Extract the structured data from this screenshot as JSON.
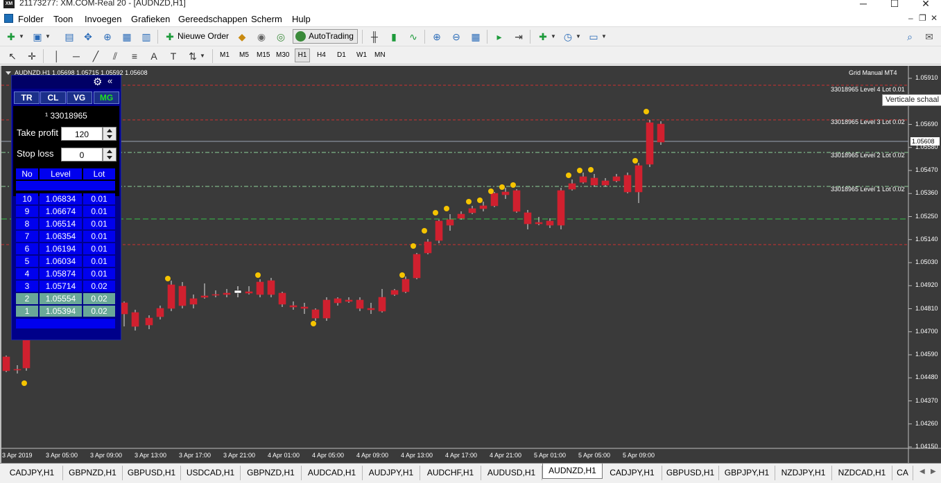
{
  "window": {
    "title": "21173277: XM.COM-Real 20 - [AUDNZD,H1]",
    "app_icon_text": "XM"
  },
  "menu": [
    "Folder",
    "Toon",
    "Invoegen",
    "Grafieken",
    "Gereedschappen",
    "Scherm",
    "Hulp"
  ],
  "toolbar": {
    "new_order_label": "Nieuwe Order",
    "autotrading_label": "AutoTrading",
    "timeframes": [
      "M1",
      "M5",
      "M15",
      "M30",
      "H1",
      "H4",
      "D1",
      "W1",
      "MN"
    ],
    "active_timeframe": "H1"
  },
  "chart": {
    "header": "AUDNZD,H1  1.05698 1.05715 1.05592 1.05608",
    "ea_label": "Grid Manual MT4",
    "tooltip": "Verticale schaal",
    "current_price": "1.05608",
    "price_ticks": [
      "1.05910",
      "1.05690",
      "1.05580",
      "1.05470",
      "1.05360",
      "1.05250",
      "1.05140",
      "1.05030",
      "1.04920",
      "1.04810",
      "1.04700",
      "1.04590",
      "1.04480",
      "1.04370",
      "1.04260",
      "1.04150"
    ],
    "time_ticks": [
      "3 Apr 2019",
      "3 Apr 05:00",
      "3 Apr 09:00",
      "3 Apr 13:00",
      "3 Apr 17:00",
      "3 Apr 21:00",
      "4 Apr 01:00",
      "4 Apr 05:00",
      "4 Apr 09:00",
      "4 Apr 13:00",
      "4 Apr 17:00",
      "4 Apr 21:00",
      "5 Apr 01:00",
      "5 Apr 05:00",
      "5 Apr 09:00"
    ],
    "level_labels": [
      "33018965 Level 4 Lot 0.01",
      "33018965 Level 3 Lot 0.02",
      "33018965 Level 2 Lot 0.02",
      "33018965 Level 1 Lot 0.02"
    ]
  },
  "panel": {
    "tabs": [
      "TR",
      "CL",
      "VG",
      "MG"
    ],
    "active_tab": "MG",
    "account": "¹ 33018965",
    "take_profit_label": "Take profit",
    "take_profit_value": "120",
    "stop_loss_label": "Stop loss",
    "stop_loss_value": "0",
    "columns": [
      "No",
      "Level",
      "Lot"
    ],
    "rows": [
      {
        "no": "10",
        "level": "1.06834",
        "lot": "0.01"
      },
      {
        "no": "9",
        "level": "1.06674",
        "lot": "0.01"
      },
      {
        "no": "8",
        "level": "1.06514",
        "lot": "0.01"
      },
      {
        "no": "7",
        "level": "1.06354",
        "lot": "0.01"
      },
      {
        "no": "6",
        "level": "1.06194",
        "lot": "0.01"
      },
      {
        "no": "5",
        "level": "1.06034",
        "lot": "0.01"
      },
      {
        "no": "4",
        "level": "1.05874",
        "lot": "0.01"
      },
      {
        "no": "3",
        "level": "1.05714",
        "lot": "0.02"
      },
      {
        "no": "2",
        "level": "1.05554",
        "lot": "0.02"
      },
      {
        "no": "1",
        "level": "1.05394",
        "lot": "0.02"
      }
    ]
  },
  "symbol_tabs": [
    "CADJPY,H1",
    "GBPNZD,H1",
    "GBPUSD,H1",
    "USDCAD,H1",
    "GBPNZD,H1",
    "AUDCAD,H1",
    "AUDJPY,H1",
    "AUDCHF,H1",
    "AUDUSD,H1",
    "AUDNZD,H1",
    "CADJPY,H1",
    "GBPUSD,H1",
    "GBPJPY,H1",
    "NZDJPY,H1",
    "NZDCAD,H1",
    "CA"
  ],
  "active_symbol_tab": "AUDNZD,H1",
  "colors": {
    "chart_bg": "#3a3a3a",
    "bull": "#ffffff",
    "bear": "#d0202f",
    "signal_dot": "#f5c400",
    "panel_bg": "#00008a",
    "grid_cell": "#0000ee"
  }
}
